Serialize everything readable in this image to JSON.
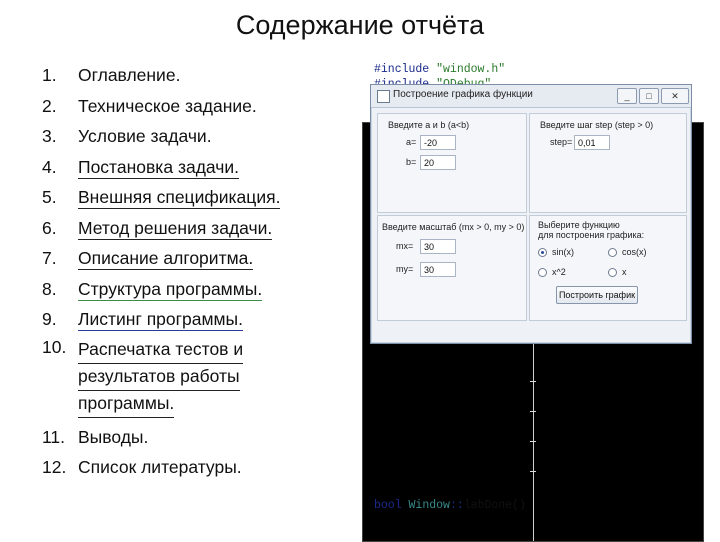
{
  "slide": {
    "title": "Содержание отчёта",
    "toc": [
      {
        "num": "1.",
        "text": "Оглавление."
      },
      {
        "num": "2.",
        "text": "Техническое задание."
      },
      {
        "num": "3.",
        "text": "Условие задачи."
      },
      {
        "num": "4.",
        "text": "Постановка задачи."
      },
      {
        "num": "5.",
        "text": "Внешняя спецификация."
      },
      {
        "num": "6.",
        "text": "Метод решения задачи."
      },
      {
        "num": "7.",
        "text": "Описание алгоритма."
      },
      {
        "num": "8.",
        "text": "Структура программы."
      },
      {
        "num": "9.",
        "text": "Листинг программы."
      },
      {
        "num": "10.",
        "lines": [
          " Распечатка тестов и ",
          "результатов работы ",
          "программы."
        ]
      },
      {
        "num": "11.",
        "text": "Выводы."
      },
      {
        "num": "12.",
        "text": "Список литературы."
      }
    ]
  },
  "screenshot": {
    "code_top": [
      {
        "kw": "#include ",
        "str": "\"window.h\""
      },
      {
        "kw": "#include ",
        "str": "\"QDebug\""
      }
    ],
    "code_bottom": {
      "type": "bool ",
      "cls": "Window",
      "sep": "::",
      "fn": "labDone()"
    },
    "window": {
      "title": "Построение графика функции",
      "buttons": {
        "minimize": "_",
        "maximize": "□",
        "close": "✕"
      },
      "range_panel": {
        "heading": "Введите a и b (a<b)",
        "a_label": "a=",
        "a_value": "-20",
        "b_label": "b=",
        "b_value": "20"
      },
      "step_panel": {
        "heading": "Введите шаг step (step > 0)",
        "step_label": "step=",
        "step_value": "0,01"
      },
      "scale_panel": {
        "heading": "Введите масштаб (mx > 0, my > 0)",
        "mx_label": "mx=",
        "mx_value": "30",
        "my_label": "my=",
        "my_value": "30"
      },
      "function_panel": {
        "heading_line1": "Выберите функцию",
        "heading_line2": "для построения графика:",
        "options": [
          "sin(x)",
          "cos(x)",
          "x^2",
          "x"
        ],
        "selected": "sin(x)",
        "plot_button": "Построить график"
      }
    }
  }
}
